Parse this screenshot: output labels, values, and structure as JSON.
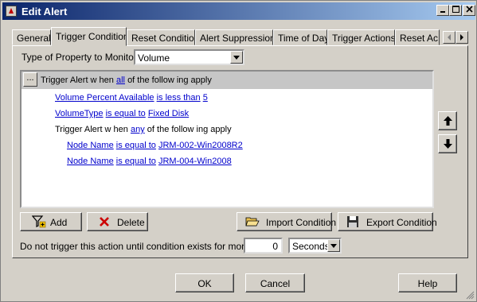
{
  "window": {
    "title": "Edit Alert"
  },
  "tabs": [
    {
      "label": "General"
    },
    {
      "label": "Trigger Condition"
    },
    {
      "label": "Reset Condition"
    },
    {
      "label": "Alert Suppression"
    },
    {
      "label": "Time of Day"
    },
    {
      "label": "Trigger Actions"
    },
    {
      "label": "Reset Ac"
    }
  ],
  "property": {
    "label": "Type of Property to Monitor:",
    "value": "Volume"
  },
  "conditions": {
    "root": {
      "prefix": "Trigger Alert w hen",
      "quantifier": "all",
      "suffix": "of the follow ing apply"
    },
    "c1": {
      "field": "Volume Percent Available",
      "op": "is less than",
      "value": "5"
    },
    "c2": {
      "field": "VolumeType",
      "op": "is equal to",
      "value": "Fixed Disk"
    },
    "group": {
      "prefix": "Trigger Alert w hen",
      "quantifier": "any",
      "suffix": "of the follow ing apply"
    },
    "c3": {
      "field": "Node Name",
      "op": "is equal to",
      "value": "JRM-002-Win2008R2"
    },
    "c4": {
      "field": "Node Name",
      "op": "is equal to",
      "value": "JRM-004-Win2008"
    }
  },
  "actions": {
    "add": "Add",
    "delete": "Delete",
    "import": "Import Condition",
    "export": "Export Condition"
  },
  "delay": {
    "label": "Do not trigger this action until condition exists for more than",
    "value": "0",
    "unit": "Seconds"
  },
  "footer": {
    "ok": "OK",
    "cancel": "Cancel",
    "help": "Help"
  }
}
